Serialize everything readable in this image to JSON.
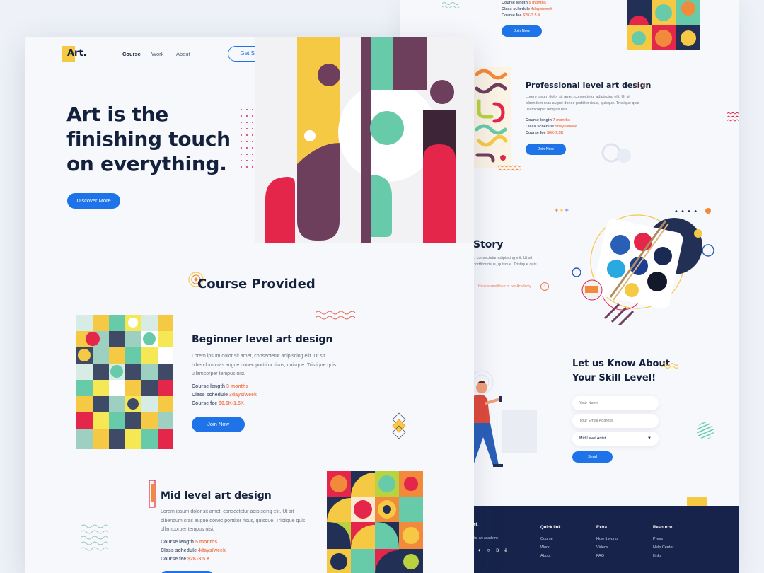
{
  "nav": {
    "logo": "Art.",
    "links": [
      "Course",
      "Work",
      "About"
    ],
    "cta": "Get Started"
  },
  "hero": {
    "title": "Art is the finishing touch on everything.",
    "button": "Discover More"
  },
  "courses_section": {
    "title": "Course Provided"
  },
  "courses": [
    {
      "title": "Beginner level art design",
      "desc": "Lorem ipsum dolor sit amet, consectetur adipiscing elit. Ut sit bibendum cras augue donec porttitor risus, quisque. Tristique quis ullamcorper tempus nisi.",
      "length_label": "Course length",
      "length": "3 months",
      "schedule_label": "Class schedule",
      "schedule": "3days/week",
      "fee_label": "Course fee",
      "fee": "$0.5K-1.5K",
      "button": "Join Now"
    },
    {
      "title": "Mid level art design",
      "desc": "Lorem ipsum dolor sit amet, consectetur adipiscing elit. Ut sit bibendum cras augue donec porttitor risus, quisque. Tristique quis ullamcorper tempus nisi.",
      "length_label": "Course length",
      "length": "5 months",
      "schedule_label": "Class schedule",
      "schedule": "4days/week",
      "fee_label": "Course fee",
      "fee": "$2K-3.5 K"
    }
  ],
  "back": {
    "top_course": {
      "length_label": "Course length",
      "length": "5 months",
      "schedule_label": "Class schedule",
      "schedule": "4days/week",
      "fee_label": "Course fee",
      "fee": "$2K-3.5 K",
      "button": "Join Now"
    },
    "pro_course": {
      "title": "Professional level art design",
      "desc": "Lorem ipsum dolor sit amet, consectetur adipiscing elit. Ut sit bibendum cras augue donec porttitor risus, quisque. Tristique quis ullamcorper tempus nisi.",
      "length_label": "Course length",
      "length": "7 months",
      "schedule_label": "Class schedule",
      "schedule": "5days/week",
      "fee_label": "Course fee",
      "fee": "$6K-7.5K",
      "button": "Join Now"
    },
    "story": {
      "title": "Story",
      "desc": "t, consectetur adipiscing elit. Ut sit porttitor risus, quisque. Tristique quis",
      "link": "Have a small tour to our Academy"
    },
    "skill": {
      "title": "Let us Know About Your Skill Level!",
      "name_placeholder": "Your Name",
      "email_placeholder": "Your Email Address",
      "select_value": "Mid Level Artist",
      "button": "Send"
    },
    "footer": {
      "logo": "rt.",
      "tagline": "ital art academy",
      "cols": [
        {
          "title": "Quick link",
          "items": [
            "Course",
            "Work",
            "About"
          ]
        },
        {
          "title": "Extra",
          "items": [
            "How it works",
            "Videos",
            "FAQ"
          ]
        },
        {
          "title": "Resource",
          "items": [
            "Press",
            "Help Center",
            "llinks"
          ]
        }
      ],
      "social_behance": "Bē"
    }
  },
  "colors": {
    "primary": "#1e73e8",
    "accent_orange": "#ef7a4f",
    "yellow": "#f6c945",
    "plum": "#6e3f5d",
    "teal": "#67cba9",
    "red": "#e3264a",
    "navy": "#17234b"
  }
}
